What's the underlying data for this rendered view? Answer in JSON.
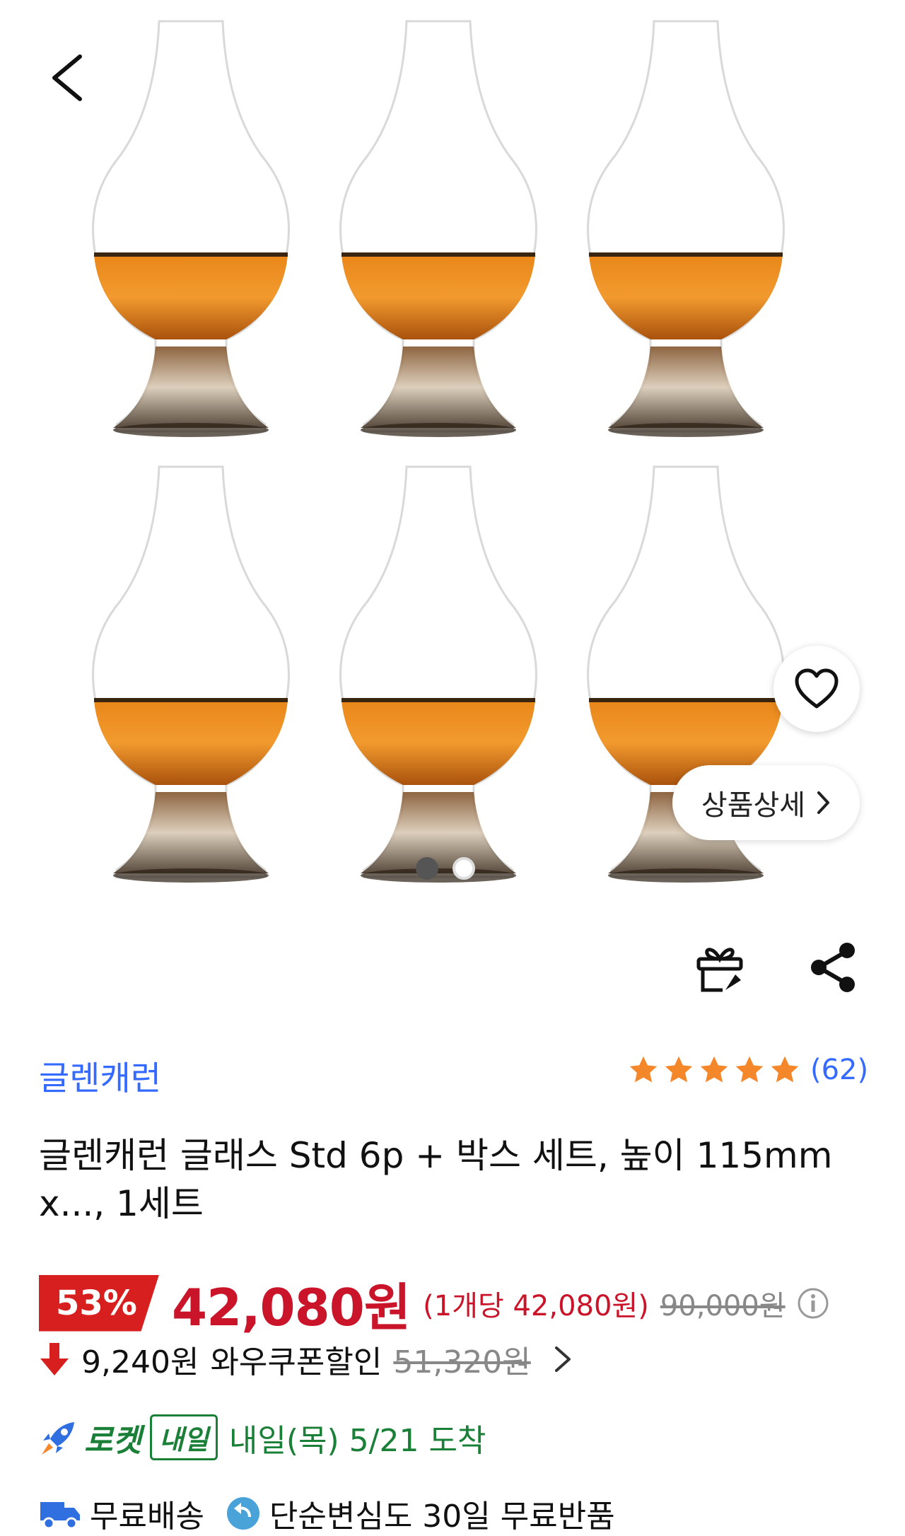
{
  "product": {
    "brand": "글렌캐런",
    "review_count": "(62)",
    "rating": 5,
    "title": "글렌캐런 글래스 Std 6p + 박스 세트, 높이 115mm x..., 1세트"
  },
  "hero": {
    "detail_label": "상품상세",
    "image_count": 2,
    "current_image": 1
  },
  "price": {
    "discount": "53%",
    "sale": "42,080원",
    "unit": "(1개당 42,080원)",
    "original": "90,000원"
  },
  "coupon": {
    "amount": "9,240원",
    "label": "와우쿠폰할인",
    "strike": "51,320원"
  },
  "delivery": {
    "rocket_label": "로켓",
    "badge": "내일",
    "arrival": "내일(목) 5/21 도착"
  },
  "shipping": {
    "free_shipping": "무료배송",
    "free_return": "단순변심도 30일 무료반품"
  },
  "colors": {
    "accent_blue": "#346aff",
    "sale_red": "#c9142a",
    "rocket_green": "#1a7f37",
    "star_orange": "#f5872b"
  }
}
